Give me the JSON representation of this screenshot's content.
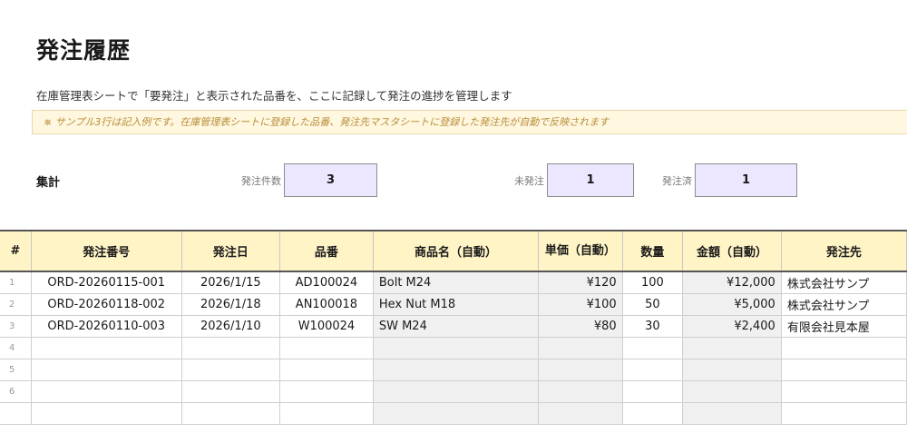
{
  "title": "発注履歴",
  "subtitle": "在庫管理表シートで「要発注」と表示された品番を、ここに記録して発注の進捗を管理します",
  "note": "※ サンプル3行は記入例です。在庫管理表シートに登録した品番、発注先マスタシートに登録した発注先が自動で反映されます",
  "summary": {
    "label": "集計",
    "order_count_label": "発注件数",
    "order_count": "3",
    "unordered_label": "未発注",
    "unordered": "1",
    "ordered_label": "発注済",
    "ordered": "1"
  },
  "table": {
    "headers": [
      "#",
      "発注番号",
      "発注日",
      "品番",
      "商品名（自動）",
      "単価（自動）",
      "数量",
      "金額（自動）",
      "発注先"
    ],
    "rows": [
      {
        "num": "1",
        "order_no": "ORD-20260115-001",
        "date": "2026/1/15",
        "part": "AD100024",
        "name": "Bolt M24",
        "price": "¥120",
        "qty": "100",
        "amount": "¥12,000",
        "supplier": "株式会社サンプ"
      },
      {
        "num": "2",
        "order_no": "ORD-20260118-002",
        "date": "2026/1/18",
        "part": "AN100018",
        "name": "Hex Nut M18",
        "price": "¥100",
        "qty": "50",
        "amount": "¥5,000",
        "supplier": "株式会社サンプ"
      },
      {
        "num": "3",
        "order_no": "ORD-20260110-003",
        "date": "2026/1/10",
        "part": "W100024",
        "name": "SW M24",
        "price": "¥80",
        "qty": "30",
        "amount": "¥2,400",
        "supplier": "有限会社見本屋"
      },
      {
        "num": "4",
        "order_no": "",
        "date": "",
        "part": "",
        "name": "",
        "price": "",
        "qty": "",
        "amount": "",
        "supplier": ""
      },
      {
        "num": "5",
        "order_no": "",
        "date": "",
        "part": "",
        "name": "",
        "price": "",
        "qty": "",
        "amount": "",
        "supplier": ""
      },
      {
        "num": "6",
        "order_no": "",
        "date": "",
        "part": "",
        "name": "",
        "price": "",
        "qty": "",
        "amount": "",
        "supplier": ""
      },
      {
        "num": "",
        "order_no": "",
        "date": "",
        "part": "",
        "name": "",
        "price": "",
        "qty": "",
        "amount": "",
        "supplier": ""
      }
    ]
  },
  "colors": {
    "header_bg": "#fff4c6",
    "kpi_bg": "#ece6ff",
    "auto_col_bg": "#f0f0f0",
    "note_bg": "#fff7e0"
  }
}
